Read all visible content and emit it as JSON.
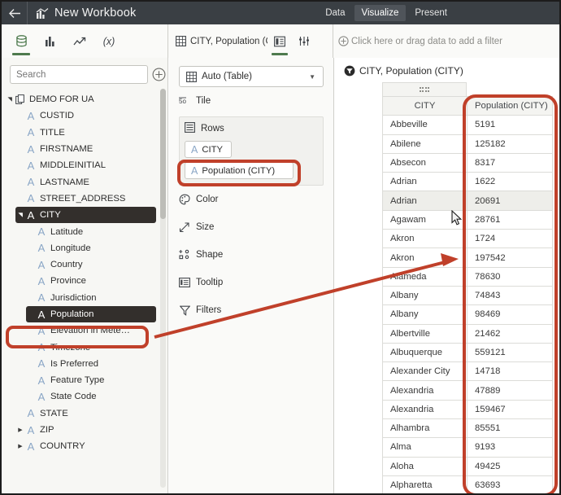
{
  "titlebar": {
    "back_icon": "back-arrow-icon",
    "workbook_icon": "workbook-chart-icon",
    "title": "New Workbook",
    "nav": [
      {
        "label": "Data",
        "active": false
      },
      {
        "label": "Visualize",
        "active": true
      },
      {
        "label": "Present",
        "active": false
      }
    ]
  },
  "toolbar": {
    "left_icons": [
      {
        "name": "database-icon",
        "active": true
      },
      {
        "name": "bar-chart-icon",
        "active": false
      },
      {
        "name": "trend-line-icon",
        "active": false
      },
      {
        "name": "calculation-fx-icon",
        "active": false
      }
    ],
    "sheet_tab": {
      "icon": "grid-table-icon",
      "label": "CITY, Population (CI..."
    },
    "mid_icons": [
      {
        "name": "layout-panel-icon",
        "active": true
      },
      {
        "name": "sliders-settings-icon",
        "active": false
      }
    ],
    "filter_hint": {
      "icon": "plus-circle-icon",
      "label": "Click here or drag data to add a filter"
    }
  },
  "sidebar": {
    "search": {
      "placeholder": "Search",
      "value": ""
    },
    "add_icon": "plus-circle-icon",
    "items": [
      {
        "label": "DEMO FOR UA",
        "indent": 0,
        "icon": "datasource-icon",
        "caret": "down",
        "selected": false
      },
      {
        "label": "CUSTID",
        "indent": 1,
        "icon": "text-field-icon",
        "caret": "none",
        "selected": false
      },
      {
        "label": "TITLE",
        "indent": 1,
        "icon": "text-field-icon",
        "caret": "none",
        "selected": false
      },
      {
        "label": "FIRSTNAME",
        "indent": 1,
        "icon": "text-field-icon",
        "caret": "none",
        "selected": false
      },
      {
        "label": "MIDDLEINITIAL",
        "indent": 1,
        "icon": "text-field-icon",
        "caret": "none",
        "selected": false
      },
      {
        "label": "LASTNAME",
        "indent": 1,
        "icon": "text-field-icon",
        "caret": "none",
        "selected": false
      },
      {
        "label": "STREET_ADDRESS",
        "indent": 1,
        "icon": "text-field-icon",
        "caret": "none",
        "selected": false
      },
      {
        "label": "CITY",
        "indent": 1,
        "icon": "text-field-icon",
        "caret": "down",
        "selected": true
      },
      {
        "label": "Latitude",
        "indent": 2,
        "icon": "text-field-icon",
        "caret": "none",
        "selected": false
      },
      {
        "label": "Longitude",
        "indent": 2,
        "icon": "text-field-icon",
        "caret": "none",
        "selected": false
      },
      {
        "label": "Country",
        "indent": 2,
        "icon": "text-field-icon",
        "caret": "none",
        "selected": false
      },
      {
        "label": "Province",
        "indent": 2,
        "icon": "text-field-icon",
        "caret": "none",
        "selected": false
      },
      {
        "label": "Jurisdiction",
        "indent": 2,
        "icon": "text-field-icon",
        "caret": "none",
        "selected": false
      },
      {
        "label": "Population",
        "indent": 2,
        "icon": "text-field-icon",
        "caret": "none",
        "selected": true
      },
      {
        "label": "Elevation in Mete…",
        "indent": 2,
        "icon": "text-field-icon",
        "caret": "none",
        "selected": false
      },
      {
        "label": "Timezone",
        "indent": 2,
        "icon": "text-field-icon",
        "caret": "none",
        "selected": false
      },
      {
        "label": "Is Preferred",
        "indent": 2,
        "icon": "text-field-icon",
        "caret": "none",
        "selected": false
      },
      {
        "label": "Feature Type",
        "indent": 2,
        "icon": "text-field-icon",
        "caret": "none",
        "selected": false
      },
      {
        "label": "State Code",
        "indent": 2,
        "icon": "text-field-icon",
        "caret": "none",
        "selected": false
      },
      {
        "label": "STATE",
        "indent": 1,
        "icon": "text-field-icon",
        "caret": "none",
        "selected": false
      },
      {
        "label": "ZIP",
        "indent": 1,
        "icon": "text-field-icon",
        "caret": "right",
        "selected": false
      },
      {
        "label": "COUNTRY",
        "indent": 1,
        "icon": "text-field-icon",
        "caret": "right",
        "selected": false
      }
    ]
  },
  "shelf": {
    "mark_type": {
      "icon": "grid-table-icon",
      "label": "Auto (Table)",
      "caret": "chevron-down-icon"
    },
    "tile": {
      "icon": "tile-icon",
      "label": "Tile"
    },
    "rows": {
      "icon": "rows-icon",
      "label": "Rows",
      "pills": [
        {
          "icon": "text-field-icon",
          "label": "CITY",
          "highlighted": false
        },
        {
          "icon": "text-field-icon",
          "label": "Population (CITY)",
          "highlighted": true
        }
      ]
    },
    "encodings": [
      {
        "icon": "color-palette-icon",
        "label": "Color"
      },
      {
        "icon": "size-icon",
        "label": "Size"
      },
      {
        "icon": "shape-icon",
        "label": "Shape"
      },
      {
        "icon": "tooltip-icon",
        "label": "Tooltip"
      },
      {
        "icon": "filter-funnel-icon",
        "label": "Filters"
      }
    ]
  },
  "viz": {
    "title_icon": "filter-black-icon",
    "title": "CITY, Population (CITY)",
    "drag_handle": "drag-dots-handle",
    "table": {
      "columns": [
        "CITY",
        "Population (CITY)"
      ],
      "rows": [
        {
          "city": "Abbeville",
          "population": "5191",
          "hovered": false
        },
        {
          "city": "Abilene",
          "population": "125182",
          "hovered": false
        },
        {
          "city": "Absecon",
          "population": "8317",
          "hovered": false
        },
        {
          "city": "Adrian",
          "population": "1622",
          "hovered": false
        },
        {
          "city": "Adrian",
          "population": "20691",
          "hovered": true
        },
        {
          "city": "Agawam",
          "population": "28761",
          "hovered": false
        },
        {
          "city": "Akron",
          "population": "1724",
          "hovered": false
        },
        {
          "city": "Akron",
          "population": "197542",
          "hovered": false
        },
        {
          "city": "Alameda",
          "population": "78630",
          "hovered": false
        },
        {
          "city": "Albany",
          "population": "74843",
          "hovered": false
        },
        {
          "city": "Albany",
          "population": "98469",
          "hovered": false
        },
        {
          "city": "Albertville",
          "population": "21462",
          "hovered": false
        },
        {
          "city": "Albuquerque",
          "population": "559121",
          "hovered": false
        },
        {
          "city": "Alexander City",
          "population": "14718",
          "hovered": false
        },
        {
          "city": "Alexandria",
          "population": "47889",
          "hovered": false
        },
        {
          "city": "Alexandria",
          "population": "159467",
          "hovered": false
        },
        {
          "city": "Alhambra",
          "population": "85551",
          "hovered": false
        },
        {
          "city": "Alma",
          "population": "9193",
          "hovered": false
        },
        {
          "city": "Aloha",
          "population": "49425",
          "hovered": false
        },
        {
          "city": "Alpharetta",
          "population": "63693",
          "hovered": false
        }
      ]
    }
  },
  "annotations": {
    "highlight_color": "#c0402a",
    "boxes": [
      {
        "name": "population-column-highlight"
      },
      {
        "name": "population-pill-highlight"
      },
      {
        "name": "population-field-highlight"
      }
    ],
    "arrow": {
      "name": "field-to-column-arrow"
    }
  },
  "cursor": {
    "name": "mouse-pointer"
  }
}
